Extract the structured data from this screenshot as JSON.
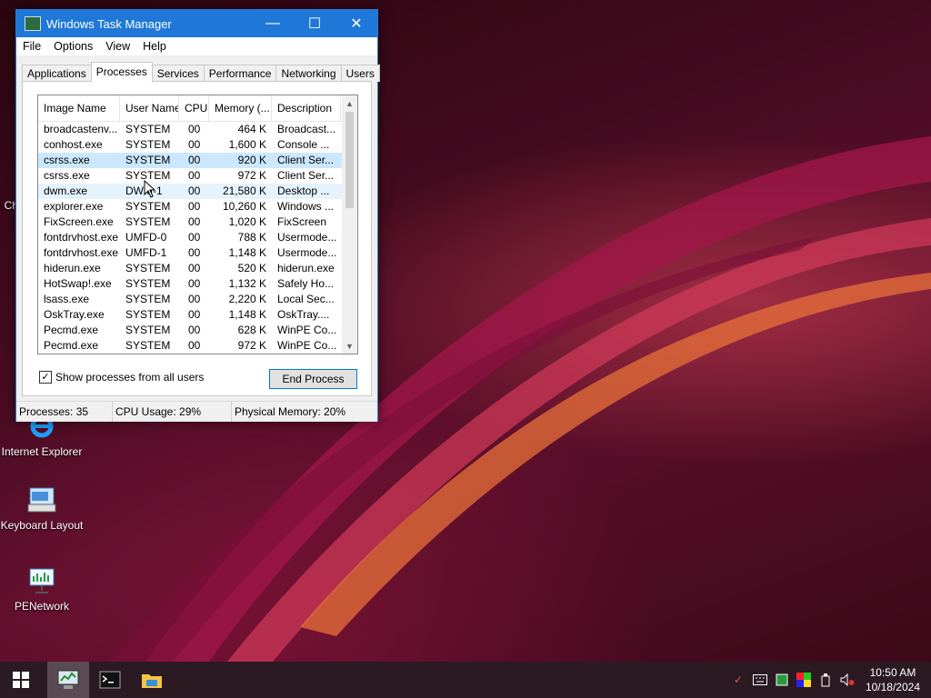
{
  "window": {
    "title": "Windows Task Manager",
    "menu": [
      "File",
      "Options",
      "View",
      "Help"
    ],
    "tabs": [
      "Applications",
      "Processes",
      "Services",
      "Performance",
      "Networking",
      "Users"
    ],
    "active_tab": "Processes"
  },
  "processes": {
    "columns": [
      "Image Name",
      "User Name",
      "CPU",
      "Memory (...",
      "Description"
    ],
    "rows": [
      [
        "broadcastenv...",
        "SYSTEM",
        "00",
        "464 K",
        "Broadcast..."
      ],
      [
        "conhost.exe",
        "SYSTEM",
        "00",
        "1,600 K",
        "Console ..."
      ],
      [
        "csrss.exe",
        "SYSTEM",
        "00",
        "920 K",
        "Client Ser..."
      ],
      [
        "csrss.exe",
        "SYSTEM",
        "00",
        "972 K",
        "Client Ser..."
      ],
      [
        "dwm.exe",
        "DWM-1",
        "00",
        "21,580 K",
        "Desktop ..."
      ],
      [
        "explorer.exe",
        "SYSTEM",
        "00",
        "10,260 K",
        "Windows ..."
      ],
      [
        "FixScreen.exe",
        "SYSTEM",
        "00",
        "1,020 K",
        "FixScreen"
      ],
      [
        "fontdrvhost.exe",
        "UMFD-0",
        "00",
        "788 K",
        "Usermode..."
      ],
      [
        "fontdrvhost.exe",
        "UMFD-1",
        "00",
        "1,148 K",
        "Usermode..."
      ],
      [
        "hiderun.exe",
        "SYSTEM",
        "00",
        "520 K",
        "hiderun.exe"
      ],
      [
        "HotSwap!.exe",
        "SYSTEM",
        "00",
        "1,132 K",
        "Safely Ho..."
      ],
      [
        "lsass.exe",
        "SYSTEM",
        "00",
        "2,220 K",
        "Local Sec..."
      ],
      [
        "OskTray.exe",
        "SYSTEM",
        "00",
        "1,148 K",
        "OskTray...."
      ],
      [
        "Pecmd.exe",
        "SYSTEM",
        "00",
        "628 K",
        "WinPE Co..."
      ],
      [
        "Pecmd.exe",
        "SYSTEM",
        "00",
        "972 K",
        "WinPE Co..."
      ]
    ],
    "selected_row": 2,
    "hover_row": 4,
    "show_all_label": "Show processes from all users",
    "show_all_checked": true,
    "end_process_label": "End Process"
  },
  "status": {
    "processes": "Processes: 35",
    "cpu": "CPU Usage: 29%",
    "memory": "Physical Memory: 20%"
  },
  "desktop_icons": [
    {
      "label": "Internet Explorer",
      "icon": "internet-explorer-icon"
    },
    {
      "label": "Keyboard Layout",
      "icon": "keyboard-layout-icon"
    },
    {
      "label": "PENetwork",
      "icon": "network-icon"
    }
  ],
  "desktop_partial_label": "Ch",
  "taskbar": {
    "time": "10:50 AM",
    "date": "10/18/2024"
  },
  "colors": {
    "titlebar": "#1f78d8",
    "selection": "#cce8ff",
    "taskbar": "#2b1a22"
  }
}
